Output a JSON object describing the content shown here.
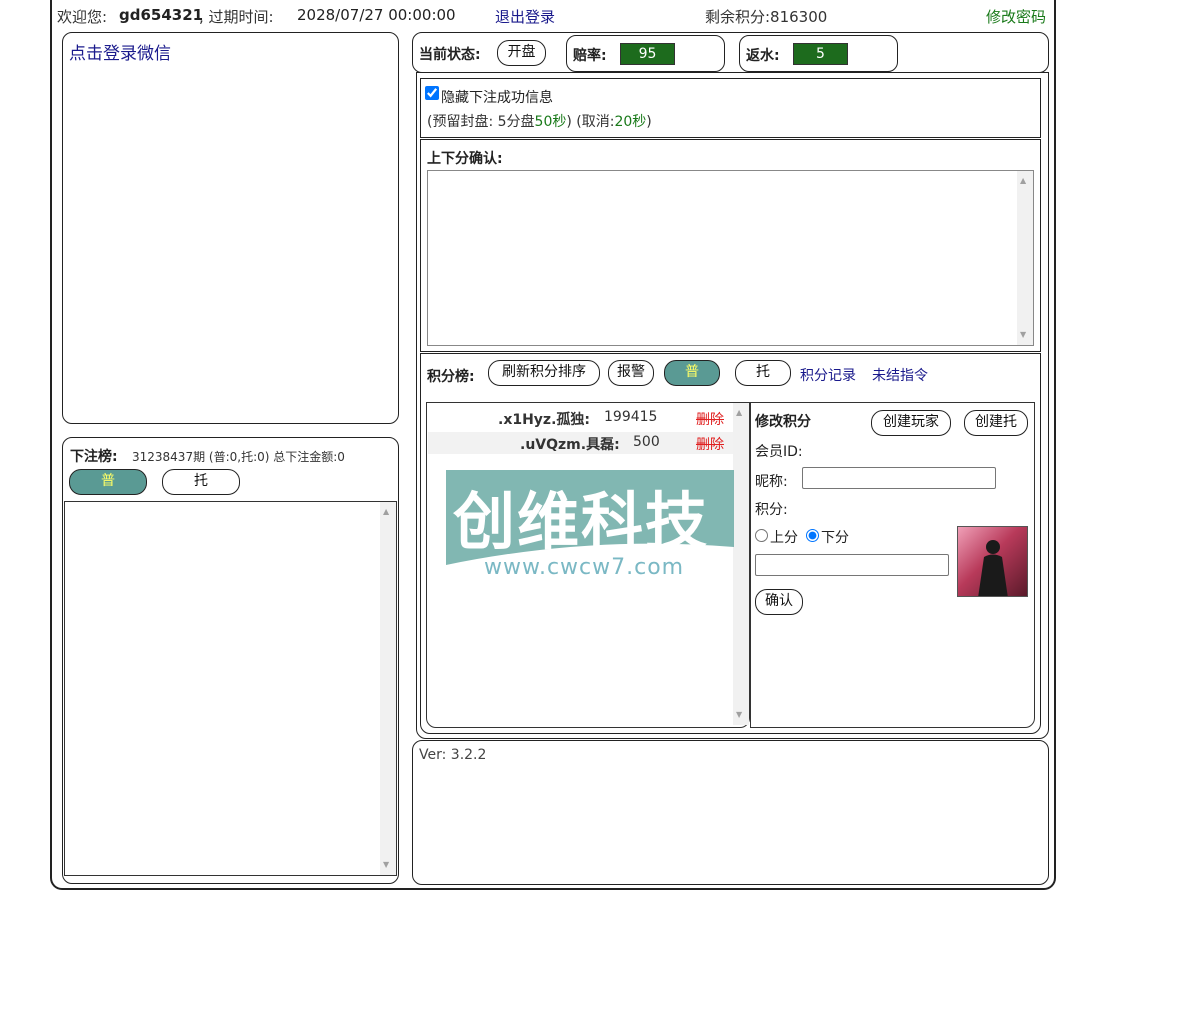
{
  "header": {
    "welcome_label": "欢迎您:",
    "username": "gd654321",
    "expire_label": ", 过期时间:",
    "expire_time": "2028/07/27 00:00:00",
    "logout": "退出登录",
    "points": "剩余积分:816300",
    "change_password": "修改密码"
  },
  "wechat": {
    "login_link": "点击登录微信"
  },
  "bets": {
    "label": "下注榜:",
    "info": "31238437期 (普:0,托:0) 总下注金额:0",
    "btn_normal": "普",
    "btn_shill": "托"
  },
  "status": {
    "label": "当前状态:",
    "state_button": "开盘",
    "odds_label": "赔率:",
    "odds_value": "95",
    "rebate_label": "返水:",
    "rebate_value": "5"
  },
  "options": {
    "hide_success_label": "隐藏下注成功信息",
    "hide_success_checked": true,
    "reserve_prefix": "(预留封盘: 5分盘",
    "reserve_seconds": "50秒",
    "cancel_prefix": ") (取消:",
    "cancel_seconds": "20秒",
    "cancel_suffix": ")"
  },
  "confirm": {
    "label": "上下分确认:"
  },
  "leaderboard": {
    "label": "积分榜:",
    "refresh": "刷新积分排序",
    "alarm": "报警",
    "normal": "普",
    "shill": "托",
    "records": "积分记录",
    "pending": "未结指令",
    "rows": [
      {
        "name": ".x1Hyz.孤独:",
        "score": "199415",
        "action": "删除"
      },
      {
        "name": ".uVQzm.具磊:",
        "score": "500",
        "action": "删除"
      }
    ]
  },
  "edit": {
    "title": "修改积分",
    "create_player": "创建玩家",
    "create_shill": "创建托",
    "member_id_label": "会员ID:",
    "nickname_label": "昵称:",
    "points_label": "积分:",
    "up_label": "上分",
    "down_label": "下分",
    "down_checked": true,
    "confirm": "确认"
  },
  "version": "Ver: 3.2.2",
  "watermark": {
    "title": "创维科技",
    "url": "www.cwcw7.com"
  },
  "colors": {
    "green_value_bg": "#1d6b1d",
    "accent_teal": "#5a9a94",
    "link_blue": "#1a1a8c",
    "delete_red": "#e02020",
    "change_pw_green": "#1a7a1a"
  }
}
